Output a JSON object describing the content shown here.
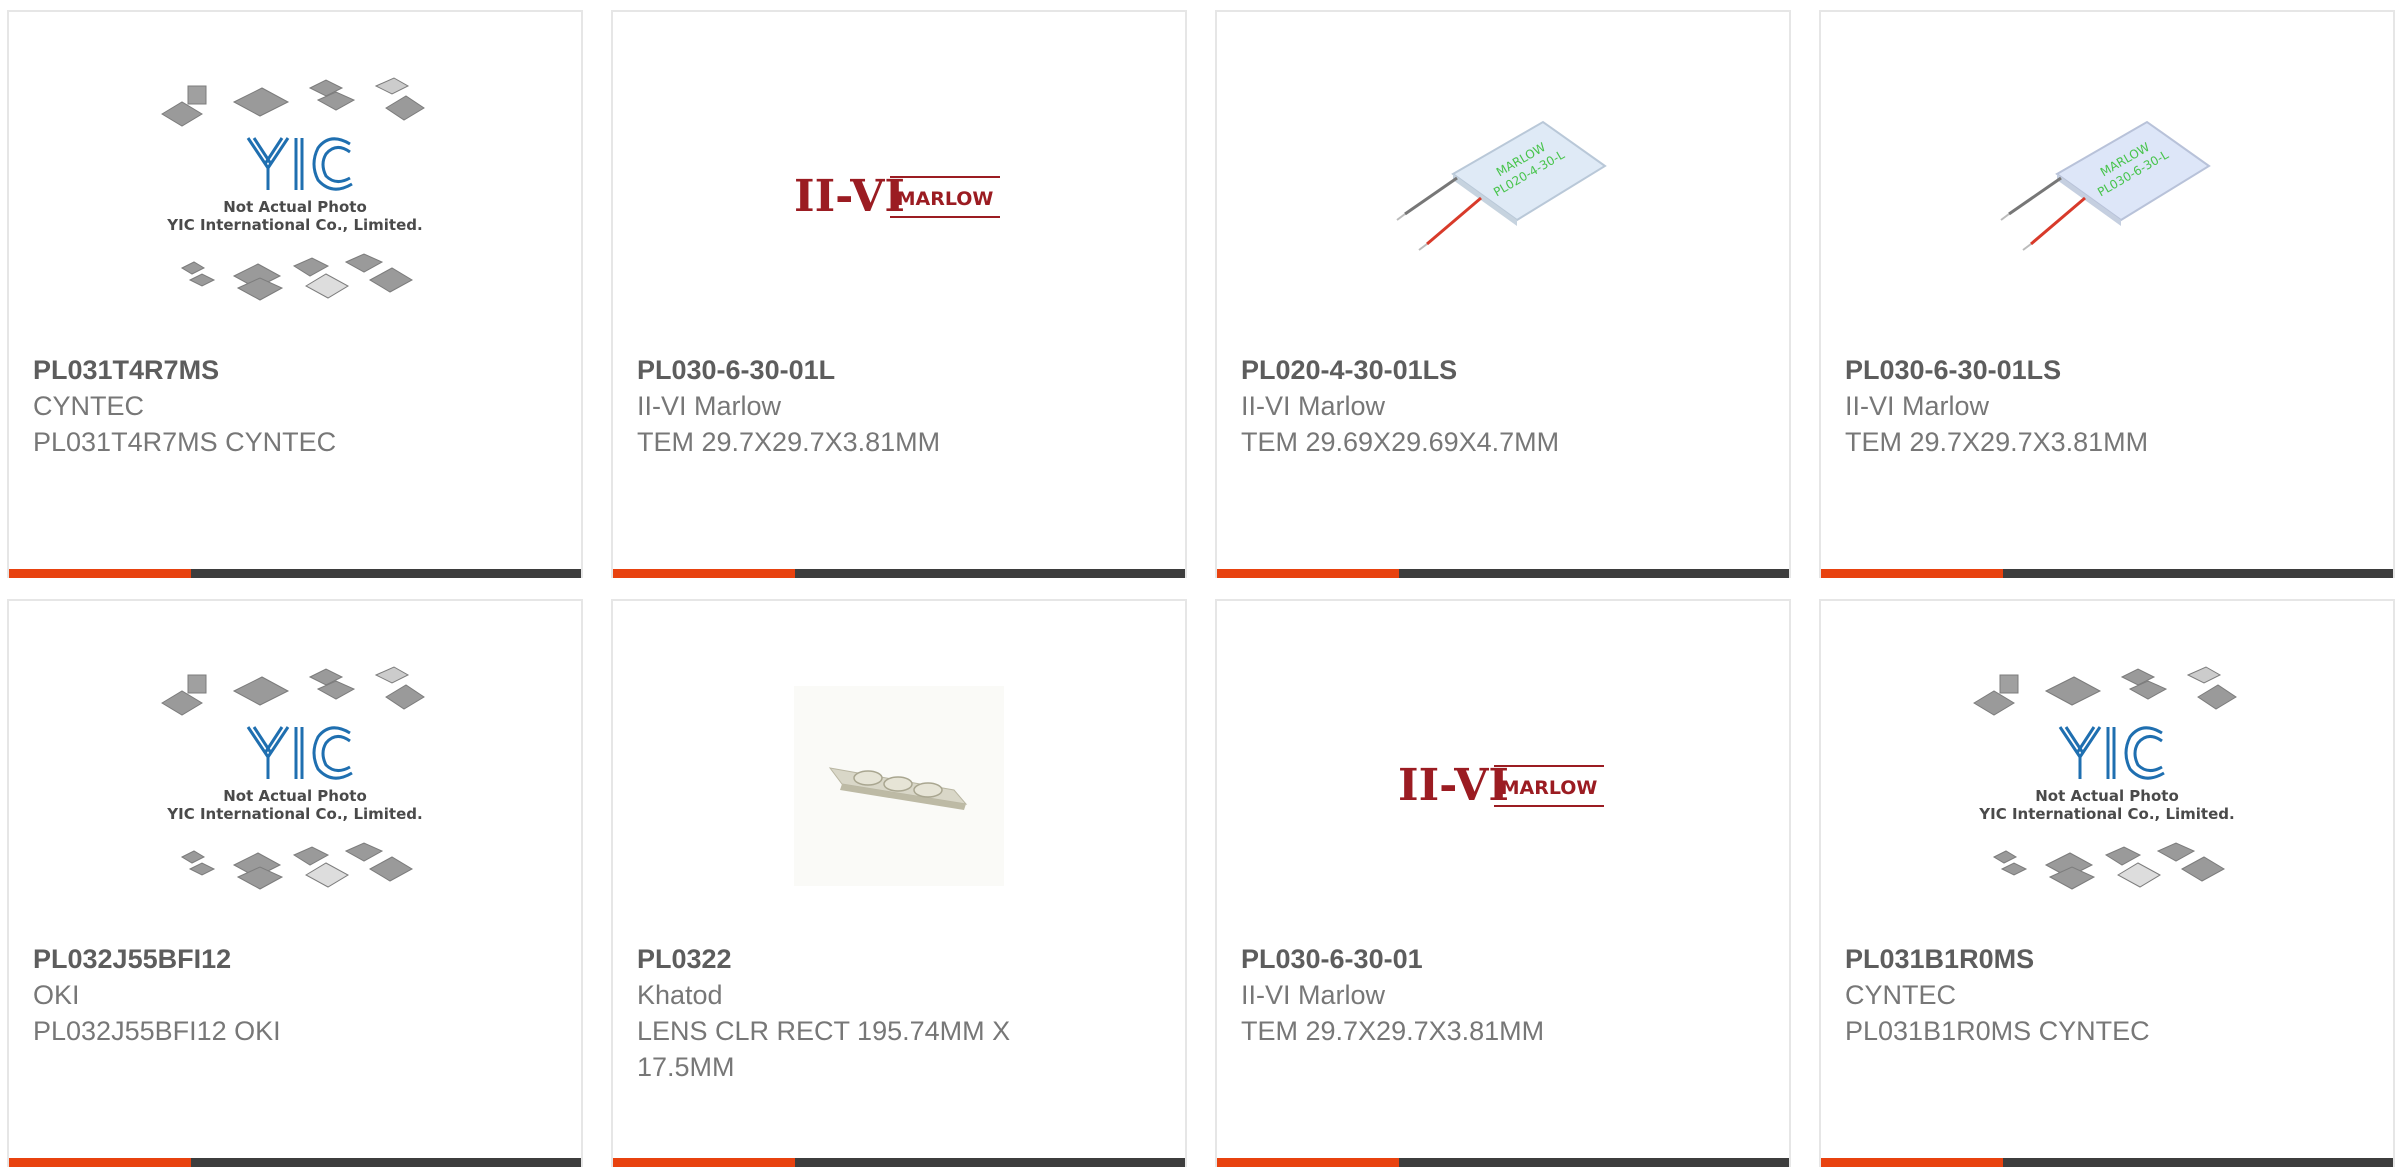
{
  "products": [
    {
      "part_number": "PL031T4R7MS",
      "manufacturer": "CYNTEC",
      "description": "PL031T4R7MS CYNTEC",
      "image": "yic-placeholder"
    },
    {
      "part_number": "PL030-6-30-01L",
      "manufacturer": "II-VI Marlow",
      "description": "TEM 29.7X29.7X3.81MM",
      "image": "marlow-logo"
    },
    {
      "part_number": "PL020-4-30-01LS",
      "manufacturer": "II-VI Marlow",
      "description": "TEM 29.69X29.69X4.7MM",
      "image": "tem-module"
    },
    {
      "part_number": "PL030-6-30-01LS",
      "manufacturer": "II-VI Marlow",
      "description": "TEM 29.7X29.7X3.81MM",
      "image": "tem-module"
    },
    {
      "part_number": "PL032J55BFI12",
      "manufacturer": "OKI",
      "description": "PL032J55BFI12 OKI",
      "image": "yic-placeholder"
    },
    {
      "part_number": "PL0322",
      "manufacturer": "Khatod",
      "description": "LENS CLR RECT 195.74MM X 17.5MM",
      "image": "lens-strip"
    },
    {
      "part_number": "PL030-6-30-01",
      "manufacturer": "II-VI Marlow",
      "description": "TEM 29.7X29.7X3.81MM",
      "image": "marlow-logo"
    },
    {
      "part_number": "PL031B1R0MS",
      "manufacturer": "CYNTEC",
      "description": "PL031B1R0MS CYNTEC",
      "image": "yic-placeholder"
    }
  ],
  "placeholder": {
    "logo_text": "YIC",
    "line1": "Not Actual Photo",
    "line2": "YIC International Co., Limited."
  },
  "marlow_logo": {
    "mark": "II-VI",
    "word": "MARLOW"
  },
  "tem_label": {
    "brand": "MARLOW",
    "model_1": "PL020-4-30-L",
    "model_2": "PL030-6-30-L"
  },
  "colors": {
    "accent": "#e8420f",
    "bar": "#3d3d3d",
    "part_number": "#5d5d5d",
    "text": "#777777",
    "yic_blue": "#1f6fb0",
    "marlow_red": "#9b1c22"
  }
}
